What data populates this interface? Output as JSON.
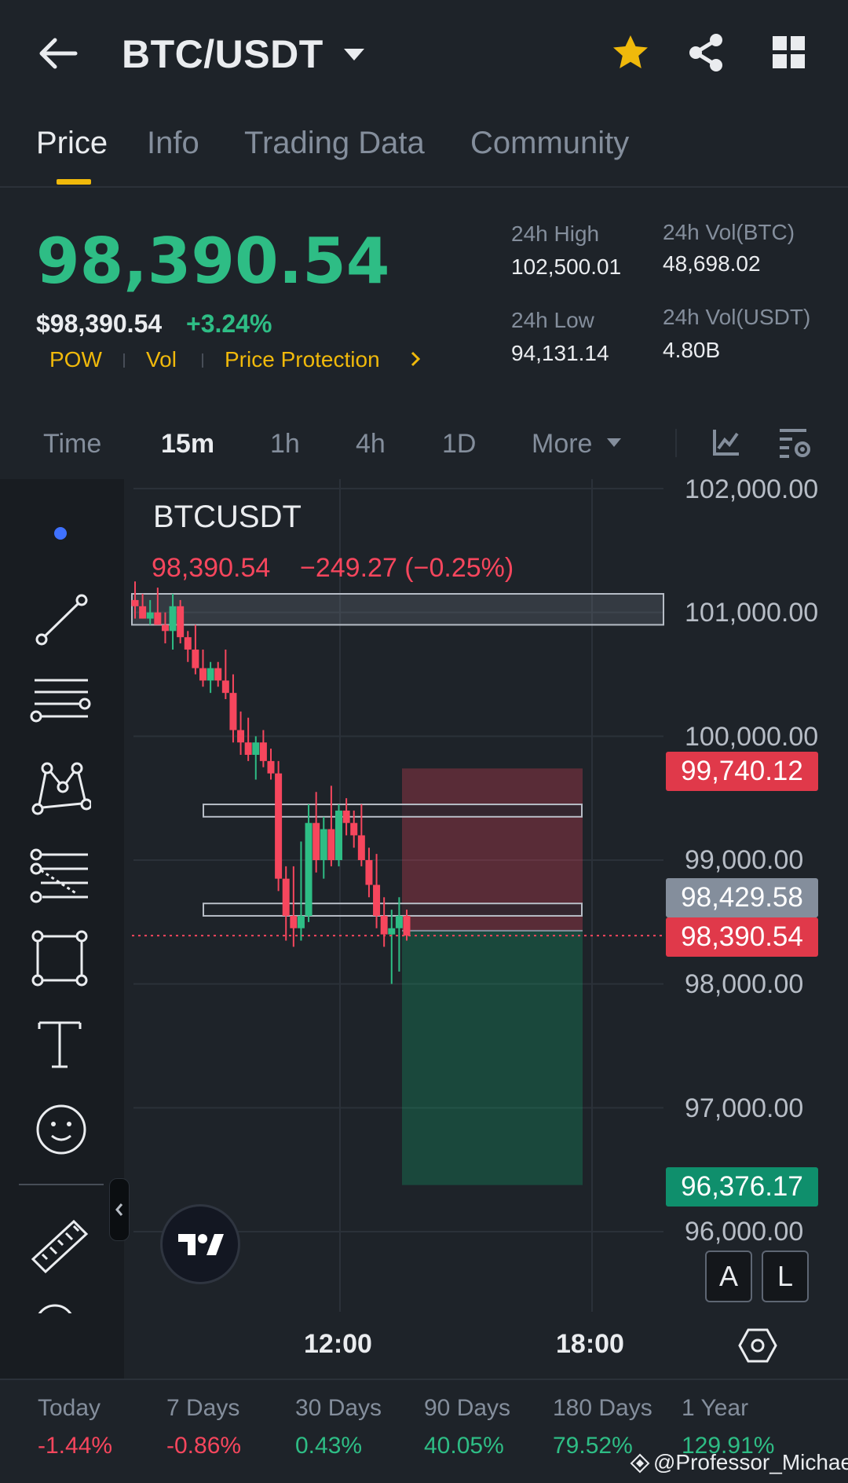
{
  "header": {
    "pair": "BTC/USDT",
    "icons": [
      "back-arrow-icon",
      "caret-down-icon",
      "star-icon",
      "share-icon",
      "grid-icon"
    ]
  },
  "tabs": [
    {
      "label": "Price",
      "active": true
    },
    {
      "label": "Info",
      "active": false
    },
    {
      "label": "Trading Data",
      "active": false
    },
    {
      "label": "Community",
      "active": false
    }
  ],
  "price": {
    "last": "98,390.54",
    "fiat": "$98,390.54",
    "change_pct": "+3.24%",
    "tags": [
      "POW",
      "Vol",
      "Price Protection"
    ]
  },
  "stats": {
    "high_label": "24h High",
    "high_value": "102,500.01",
    "low_label": "24h Low",
    "low_value": "94,131.14",
    "vol_btc_label": "24h Vol(BTC)",
    "vol_btc_value": "48,698.02",
    "vol_usdt_label": "24h Vol(USDT)",
    "vol_usdt_value": "4.80B"
  },
  "intervals": [
    {
      "label": "Time",
      "active": false
    },
    {
      "label": "15m",
      "active": true
    },
    {
      "label": "1h",
      "active": false
    },
    {
      "label": "4h",
      "active": false
    },
    {
      "label": "1D",
      "active": false
    },
    {
      "label": "More",
      "active": false
    }
  ],
  "chart": {
    "symbol": "BTCUSDT",
    "legend_price": "98,390.54",
    "legend_change": "−249.27 (−0.25%)",
    "axis_labels": [
      "102,000.00",
      "101,000.00",
      "100,000.00",
      "99,000.00",
      "98,000.00",
      "97,000.00",
      "96,000.00"
    ],
    "tags": {
      "stop": "99,740.12",
      "mark": "98,429.58",
      "last": "98,390.54",
      "target": "96,376.17"
    },
    "time_labels": [
      "12:00",
      "18:00"
    ],
    "al": [
      "A",
      "L"
    ],
    "colors": {
      "up": "#2ebd85",
      "down": "#f6465d",
      "accent": "#f0b90b"
    }
  },
  "chart_data": {
    "type": "candlestick",
    "title": "BTCUSDT",
    "interval": "15m",
    "ylim": [
      95500,
      102100
    ],
    "y_ticks": [
      102000,
      101000,
      100000,
      99000,
      98000,
      97000,
      96000
    ],
    "x_ticks": [
      "12:00",
      "18:00"
    ],
    "candles": [
      {
        "o": 101100,
        "h": 101250,
        "l": 100950,
        "c": 101050
      },
      {
        "o": 101050,
        "h": 101150,
        "l": 100950,
        "c": 100950
      },
      {
        "o": 100950,
        "h": 101100,
        "l": 100900,
        "c": 101000
      },
      {
        "o": 101000,
        "h": 101200,
        "l": 100900,
        "c": 100900
      },
      {
        "o": 100900,
        "h": 101000,
        "l": 100750,
        "c": 100850
      },
      {
        "o": 100850,
        "h": 101150,
        "l": 100700,
        "c": 101050
      },
      {
        "o": 101050,
        "h": 101100,
        "l": 100750,
        "c": 100800
      },
      {
        "o": 100800,
        "h": 100850,
        "l": 100600,
        "c": 100700
      },
      {
        "o": 100700,
        "h": 100900,
        "l": 100500,
        "c": 100550
      },
      {
        "o": 100550,
        "h": 100700,
        "l": 100400,
        "c": 100450
      },
      {
        "o": 100450,
        "h": 100600,
        "l": 100350,
        "c": 100550
      },
      {
        "o": 100550,
        "h": 100600,
        "l": 100400,
        "c": 100450
      },
      {
        "o": 100450,
        "h": 100700,
        "l": 100300,
        "c": 100350
      },
      {
        "o": 100350,
        "h": 100500,
        "l": 99950,
        "c": 100050
      },
      {
        "o": 100050,
        "h": 100200,
        "l": 99850,
        "c": 99950
      },
      {
        "o": 99950,
        "h": 100150,
        "l": 99800,
        "c": 99850
      },
      {
        "o": 99850,
        "h": 100000,
        "l": 99650,
        "c": 99950
      },
      {
        "o": 99950,
        "h": 100050,
        "l": 99750,
        "c": 99800
      },
      {
        "o": 99800,
        "h": 99900,
        "l": 99650,
        "c": 99700
      },
      {
        "o": 99700,
        "h": 99800,
        "l": 98750,
        "c": 98850
      },
      {
        "o": 98850,
        "h": 98950,
        "l": 98350,
        "c": 98550
      },
      {
        "o": 98550,
        "h": 98950,
        "l": 98300,
        "c": 98450
      },
      {
        "o": 98450,
        "h": 99150,
        "l": 98350,
        "c": 98550
      },
      {
        "o": 98550,
        "h": 99450,
        "l": 98500,
        "c": 99300
      },
      {
        "o": 99300,
        "h": 99550,
        "l": 98900,
        "c": 99000
      },
      {
        "o": 99000,
        "h": 99350,
        "l": 98850,
        "c": 99250
      },
      {
        "o": 99250,
        "h": 99600,
        "l": 98950,
        "c": 99000
      },
      {
        "o": 99000,
        "h": 99450,
        "l": 98950,
        "c": 99400
      },
      {
        "o": 99400,
        "h": 99500,
        "l": 99200,
        "c": 99300
      },
      {
        "o": 99300,
        "h": 99400,
        "l": 99100,
        "c": 99200
      },
      {
        "o": 99200,
        "h": 99450,
        "l": 98950,
        "c": 99000
      },
      {
        "o": 99000,
        "h": 99100,
        "l": 98700,
        "c": 98800
      },
      {
        "o": 98800,
        "h": 99050,
        "l": 98450,
        "c": 98550
      },
      {
        "o": 98550,
        "h": 98700,
        "l": 98300,
        "c": 98400
      },
      {
        "o": 98400,
        "h": 98600,
        "l": 98000,
        "c": 98450
      },
      {
        "o": 98450,
        "h": 98700,
        "l": 98100,
        "c": 98550
      },
      {
        "o": 98550,
        "h": 98600,
        "l": 98350,
        "c": 98390.54
      }
    ],
    "zones": [
      {
        "from": 100900,
        "to": 101150
      },
      {
        "from": 99350,
        "to": 99450
      },
      {
        "from": 98550,
        "to": 98650
      }
    ],
    "position": {
      "stop": 99740.12,
      "entry": 98429.58,
      "target": 96376.17
    }
  },
  "performance": [
    {
      "label": "Today",
      "value": "-1.44%",
      "dir": "neg"
    },
    {
      "label": "7 Days",
      "value": "-0.86%",
      "dir": "neg"
    },
    {
      "label": "30 Days",
      "value": "0.43%",
      "dir": "pos"
    },
    {
      "label": "90 Days",
      "value": "40.05%",
      "dir": "pos"
    },
    {
      "label": "180 Days",
      "value": "79.52%",
      "dir": "pos"
    },
    {
      "label": "1 Year",
      "value": "129.91%",
      "dir": "pos"
    }
  ],
  "watermark": "@Professor_Michael"
}
